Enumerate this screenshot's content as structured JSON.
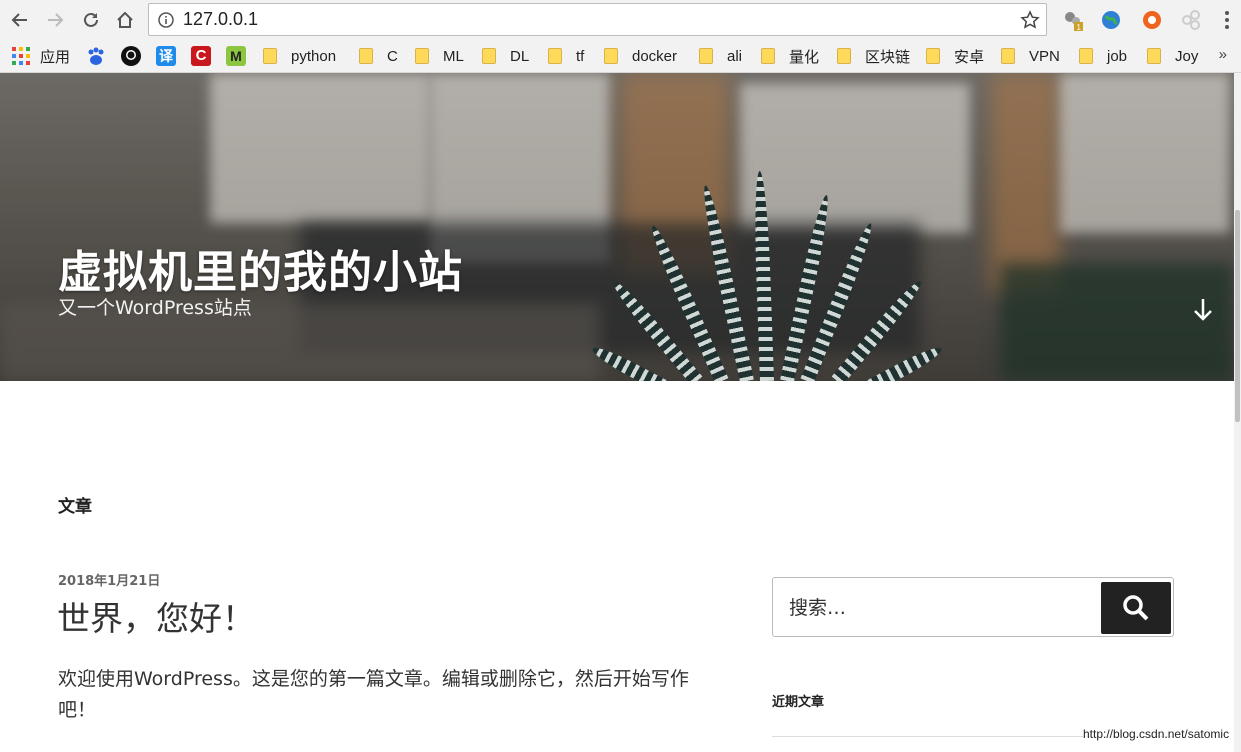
{
  "browser": {
    "url": "127.0.0.1",
    "buttons": {
      "back": "back-icon",
      "forward": "forward-icon",
      "reload": "reload-icon",
      "home": "home-icon"
    },
    "extension_badge": "1"
  },
  "bookmarks": {
    "apps_label": "应用",
    "icons": [
      "baidu-icon",
      "github-icon",
      "translate-icon",
      "csdn-icon",
      "mendeley-icon"
    ],
    "translate_glyph": "译",
    "csdn_glyph": "C",
    "mendeley_glyph": "M",
    "folders": [
      "python",
      "C",
      "ML",
      "DL",
      "tf",
      "docker",
      "ali",
      "量化",
      "区块链",
      "安卓",
      "VPN",
      "job",
      "Joy"
    ],
    "more": "»"
  },
  "hero": {
    "site_title": "虚拟机里的我的小站",
    "site_description": "又一个WordPress站点"
  },
  "main": {
    "heading": "文章",
    "post": {
      "date": "2018年1月21日",
      "title": "世界，您好！",
      "excerpt": "欢迎使用WordPress。这是您的第一篇文章。编辑或删除它，然后开始写作吧！"
    }
  },
  "sidebar": {
    "search_placeholder": "搜索…",
    "recent_posts_title": "近期文章"
  },
  "watermark": "http://blog.csdn.net/satomic",
  "colors": {
    "search_button": "#222222",
    "toolbar": "#f2f2f2",
    "folder": "#ffd95a"
  }
}
